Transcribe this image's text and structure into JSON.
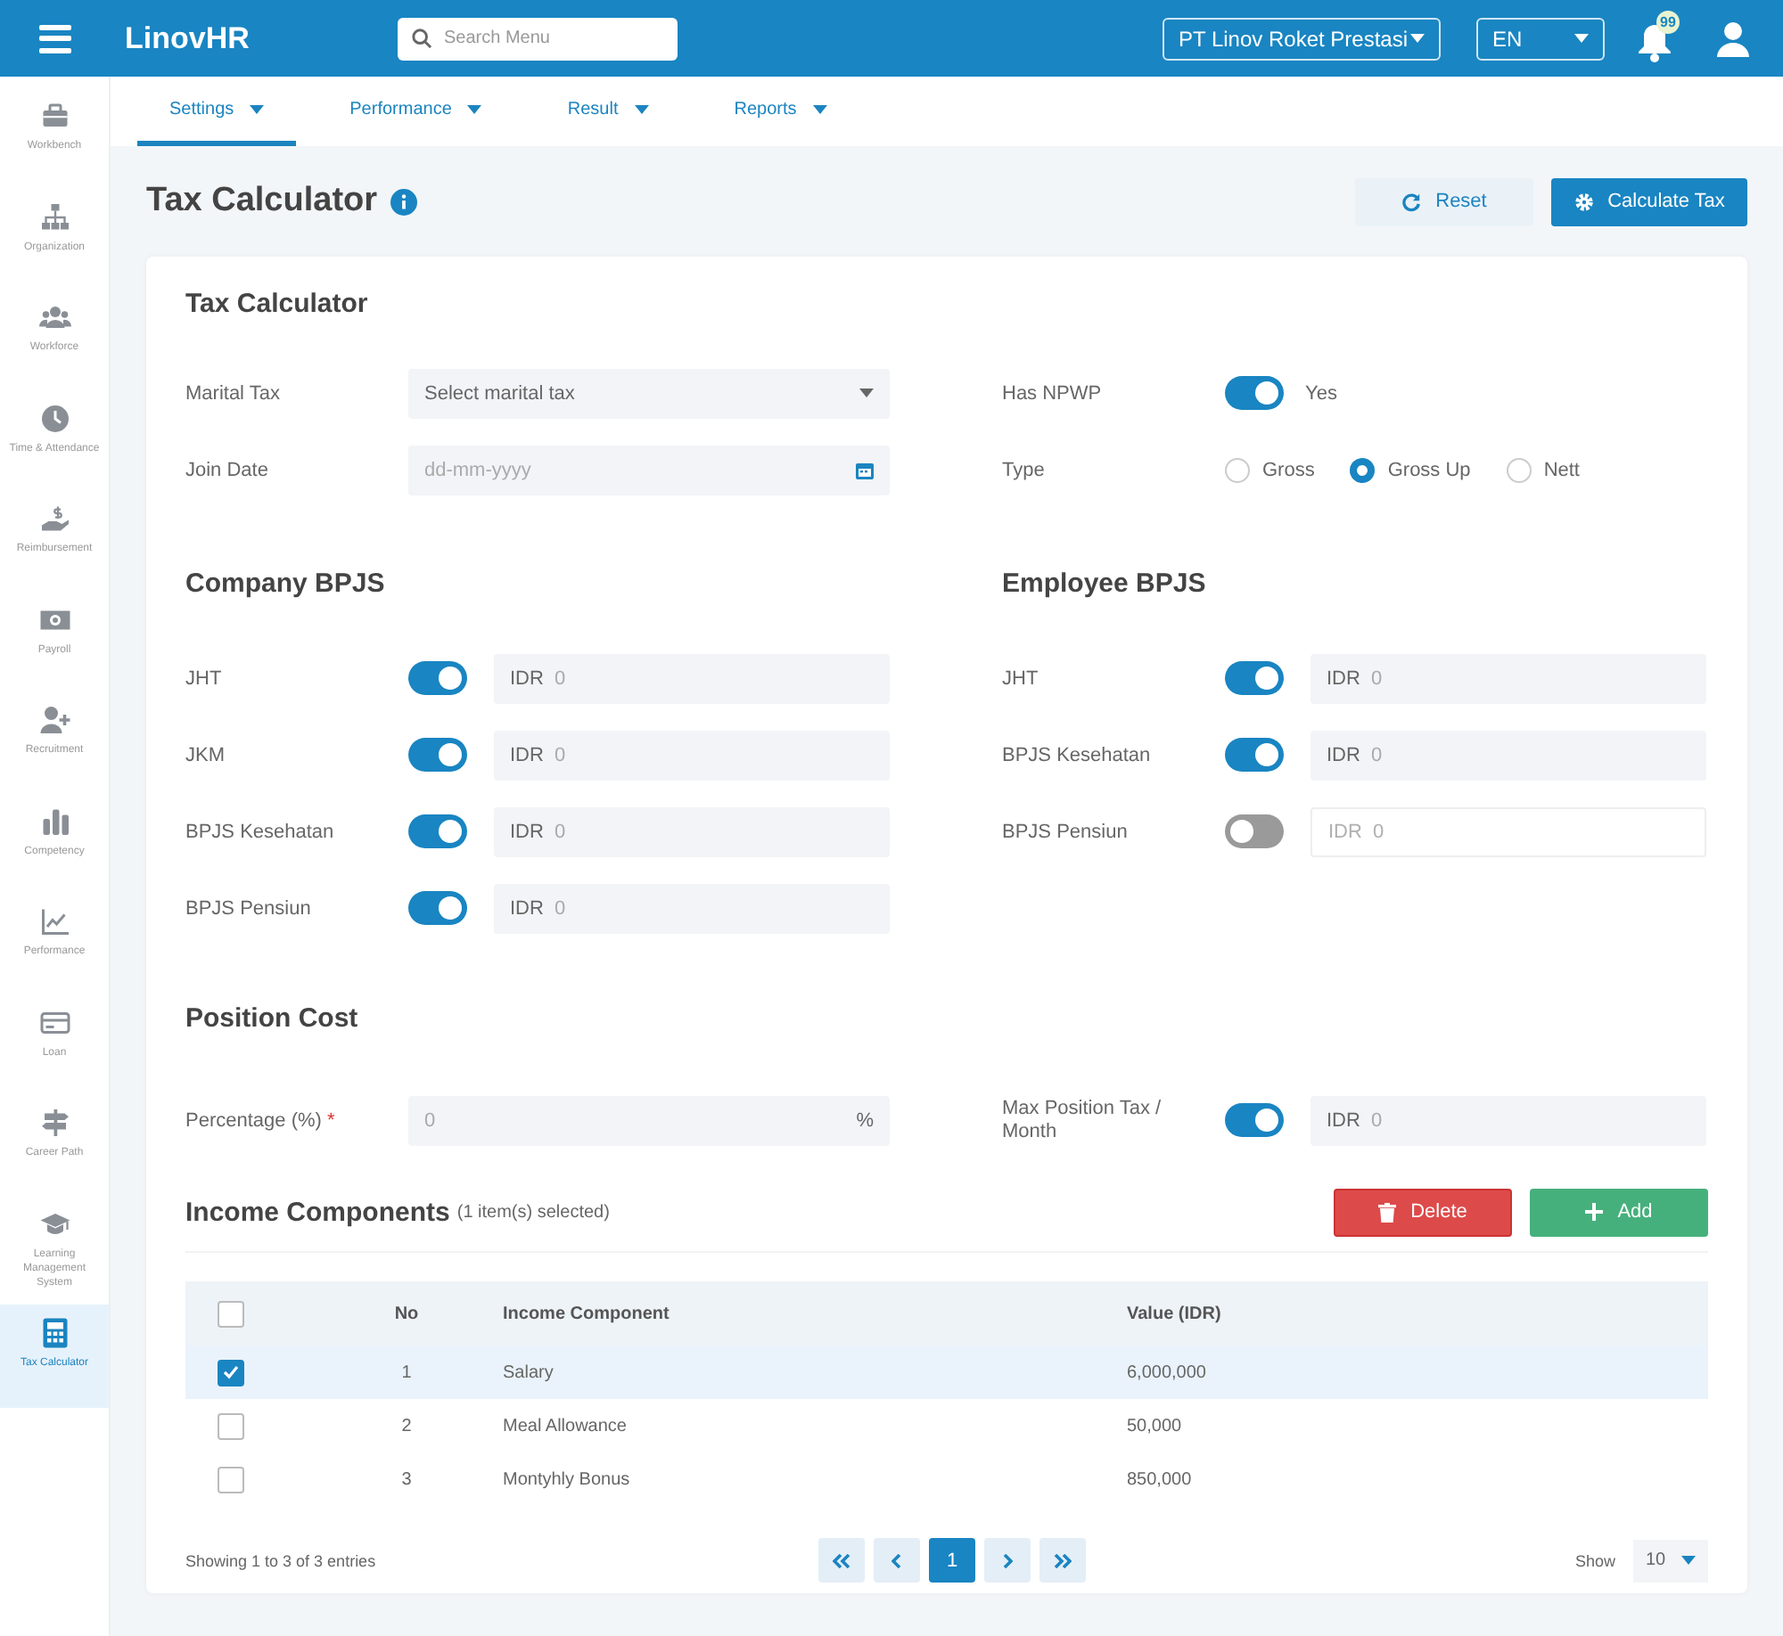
{
  "topbar": {
    "logo": "LinovHR",
    "search": {
      "placeholder": "Search Menu"
    },
    "company": "PT Linov Roket Prestasi",
    "language": "EN",
    "notification_count": "99"
  },
  "sidebar": {
    "items": [
      {
        "label": "Workbench",
        "selected": false
      },
      {
        "label": "Organization",
        "selected": false
      },
      {
        "label": "Workforce",
        "selected": false
      },
      {
        "label": "Time & Attendance",
        "selected": false
      },
      {
        "label": "Reimbursement",
        "selected": false
      },
      {
        "label": "Payroll",
        "selected": false
      },
      {
        "label": "Recruitment",
        "selected": false
      },
      {
        "label": "Competency",
        "selected": false
      },
      {
        "label": "Performance",
        "selected": false
      },
      {
        "label": "Loan",
        "selected": false
      },
      {
        "label": "Career Path",
        "selected": false
      },
      {
        "label": "Learning Management System",
        "selected": false
      },
      {
        "label": "Tax Calculator",
        "selected": true
      }
    ]
  },
  "tabs": [
    {
      "label": "Settings",
      "selected": true
    },
    {
      "label": "Performance",
      "selected": false
    },
    {
      "label": "Result",
      "selected": false
    },
    {
      "label": "Reports",
      "selected": false
    }
  ],
  "page": {
    "title": "Tax Calculator",
    "buttons": [
      {
        "label": "Reset",
        "kind": "reset"
      },
      {
        "label": "Calculate Tax",
        "kind": "calculate"
      }
    ]
  },
  "card": {
    "title": "Tax Calculator",
    "marital_tax": {
      "label": "Marital Tax",
      "placeholder": "Select marital tax"
    },
    "join_date": {
      "label": "Join Date",
      "placeholder": "dd-mm-yyyy"
    },
    "has_npwp": {
      "label": "Has NPWP",
      "on": true,
      "text": "Yes"
    },
    "type": {
      "label": "Type",
      "options": [
        {
          "label": "Gross",
          "selected": false
        },
        {
          "label": "Gross Up",
          "selected": true
        },
        {
          "label": "Nett",
          "selected": false
        }
      ]
    },
    "company_bpjs": {
      "title": "Company BPJS",
      "rows": [
        {
          "label": "JHT",
          "on": true,
          "prefix": "IDR",
          "placeholder": "0"
        },
        {
          "label": "JKM",
          "on": true,
          "prefix": "IDR",
          "placeholder": "0"
        },
        {
          "label": "BPJS Kesehatan",
          "on": true,
          "prefix": "IDR",
          "placeholder": "0"
        },
        {
          "label": "BPJS Pensiun",
          "on": true,
          "prefix": "IDR",
          "placeholder": "0"
        }
      ]
    },
    "employee_bpjs": {
      "title": "Employee BPJS",
      "rows": [
        {
          "label": "JHT",
          "on": true,
          "prefix": "IDR",
          "placeholder": "0"
        },
        {
          "label": "BPJS Kesehatan",
          "on": true,
          "prefix": "IDR",
          "placeholder": "0"
        },
        {
          "label": "BPJS Pensiun",
          "on": false,
          "prefix": "IDR",
          "placeholder": "0"
        }
      ]
    },
    "position_cost": {
      "title": "Position Cost",
      "percentage": {
        "label": "Percentage (%)",
        "required_mark": "*",
        "placeholder": "0",
        "suffix": "%"
      },
      "max_position_tax": {
        "label": "Max Position Tax / Month",
        "on": true,
        "prefix": "IDR",
        "placeholder": "0"
      }
    },
    "income": {
      "title": "Income Components",
      "note": "(1 item(s) selected)",
      "delete": "Delete",
      "add": "Add",
      "all_checked": false,
      "columns": [
        "No",
        "Income Component",
        "Value (IDR)"
      ],
      "rows": [
        {
          "no": "1",
          "component": "Salary",
          "value": "6,000,000",
          "selected": true
        },
        {
          "no": "2",
          "component": "Meal Allowance",
          "value": "50,000",
          "selected": false
        },
        {
          "no": "3",
          "component": "Montyhly Bonus",
          "value": "850,000",
          "selected": false
        }
      ],
      "showing": "Showing 1 to 3 of 3 entries",
      "pages": [
        {
          "label": "1",
          "selected": true
        }
      ],
      "show_label": "Show",
      "page_size": "10"
    }
  }
}
